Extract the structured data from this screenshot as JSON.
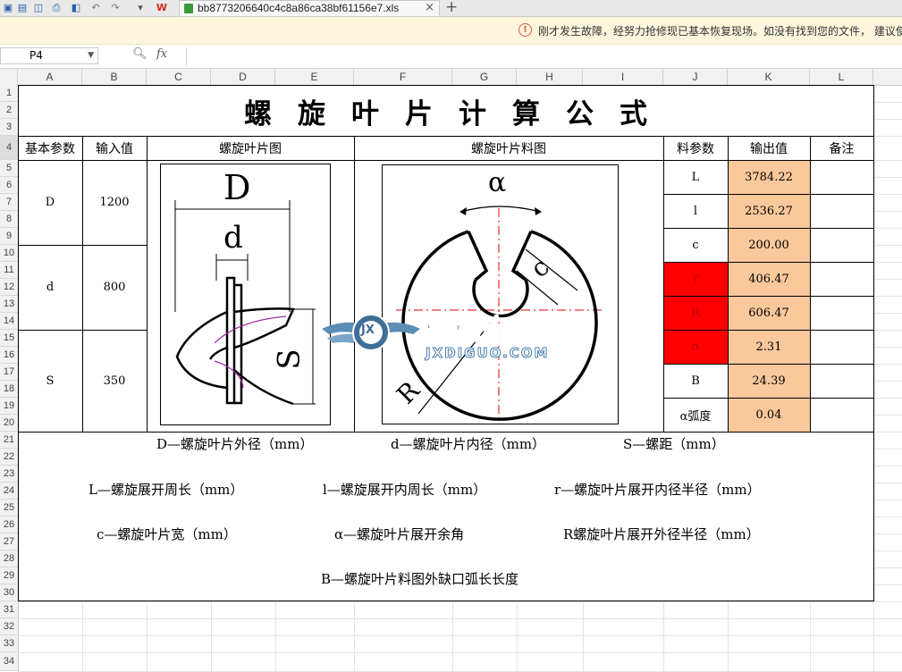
{
  "tab": {
    "filename": "bb8773206640c4c8a86ca38bf61156e7.xls",
    "close": "×",
    "add": "+"
  },
  "notice": {
    "icon": "warning-circle-icon",
    "text": "刚才发生故障，经努力抢修现已基本恢复现场。如没有找到您的文件， 建议使"
  },
  "formula_bar": {
    "cell_ref": "P4",
    "zoom_icon": "zoom-icon",
    "fx": "fx",
    "value": ""
  },
  "columns": [
    "A",
    "B",
    "C",
    "D",
    "E",
    "F",
    "G",
    "H",
    "I",
    "J",
    "K",
    "L"
  ],
  "rows": [
    "1",
    "2",
    "3",
    "4",
    "5",
    "6",
    "7",
    "8",
    "9",
    "10",
    "11",
    "12",
    "13",
    "14",
    "15",
    "16",
    "17",
    "18",
    "19",
    "20",
    "21",
    "22",
    "23",
    "24",
    "25",
    "26",
    "27",
    "28",
    "29",
    "30",
    "31",
    "32",
    "33",
    "34"
  ],
  "sheet": {
    "title": "螺旋叶片计算公式",
    "headers": {
      "base_param": "基本参数",
      "input_value": "输入值",
      "blade_drawing": "螺旋叶片图",
      "material_drawing": "螺旋叶片料图",
      "mat_param": "料参数",
      "output_value": "输出值",
      "remark": "备注"
    },
    "inputs": [
      {
        "name": "D",
        "value": "1200"
      },
      {
        "name": "d",
        "value": "800"
      },
      {
        "name": "S",
        "value": "350"
      }
    ],
    "outputs": [
      {
        "name": "L",
        "value": "3784.22",
        "highlight": false
      },
      {
        "name": "l",
        "value": "2536.27",
        "highlight": false
      },
      {
        "name": "c",
        "value": "200.00",
        "highlight": false
      },
      {
        "name": "r",
        "value": "406.47",
        "highlight": true
      },
      {
        "name": "R",
        "value": "606.47",
        "highlight": true
      },
      {
        "name": "α",
        "value": "2.31",
        "highlight": true
      },
      {
        "name": "B",
        "value": "24.39",
        "highlight": false
      },
      {
        "name": "α弧度",
        "value": "0.04",
        "highlight": false
      }
    ],
    "drawing_labels": {
      "D": "D",
      "d": "d",
      "S": "S",
      "alpha": "α",
      "c": "c",
      "R": "R"
    },
    "descriptions": {
      "D": "D—螺旋叶片外径（mm）",
      "d": "d—螺旋叶片内径（mm）",
      "S": "S—螺距（mm）",
      "L": "L—螺旋展开周长（mm）",
      "l": "l—螺旋展开内周长（mm）",
      "r": "r—螺旋叶片展开内径半径（mm）",
      "c": "c—螺旋叶片宽（mm）",
      "alpha": "α—螺旋叶片展开余角",
      "R": "R螺旋叶片展开外径半径（mm）",
      "B": "B—螺旋叶片料图外缺口弧长长度"
    }
  },
  "watermark": {
    "cn": "机械帝国",
    "en": "JXDIGUO.COM",
    "badge": "JX"
  },
  "colors": {
    "highlight_red": "#ff0000",
    "output_orange": "#fac89b",
    "notice_bg": "#fdf6dc"
  }
}
